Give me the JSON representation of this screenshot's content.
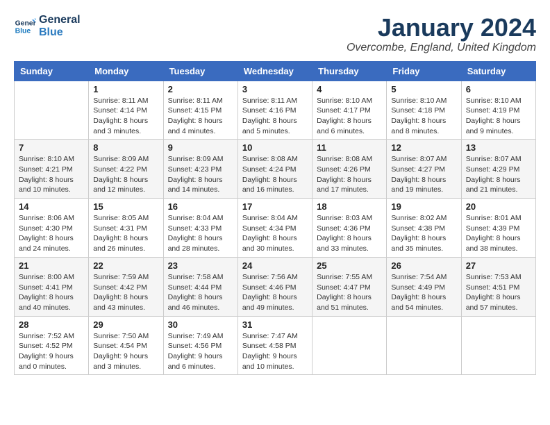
{
  "header": {
    "logo_line1": "General",
    "logo_line2": "Blue",
    "month_title": "January 2024",
    "location": "Overcombe, England, United Kingdom"
  },
  "days_of_week": [
    "Sunday",
    "Monday",
    "Tuesday",
    "Wednesday",
    "Thursday",
    "Friday",
    "Saturday"
  ],
  "weeks": [
    [
      {
        "day": "",
        "info": ""
      },
      {
        "day": "1",
        "info": "Sunrise: 8:11 AM\nSunset: 4:14 PM\nDaylight: 8 hours\nand 3 minutes."
      },
      {
        "day": "2",
        "info": "Sunrise: 8:11 AM\nSunset: 4:15 PM\nDaylight: 8 hours\nand 4 minutes."
      },
      {
        "day": "3",
        "info": "Sunrise: 8:11 AM\nSunset: 4:16 PM\nDaylight: 8 hours\nand 5 minutes."
      },
      {
        "day": "4",
        "info": "Sunrise: 8:10 AM\nSunset: 4:17 PM\nDaylight: 8 hours\nand 6 minutes."
      },
      {
        "day": "5",
        "info": "Sunrise: 8:10 AM\nSunset: 4:18 PM\nDaylight: 8 hours\nand 8 minutes."
      },
      {
        "day": "6",
        "info": "Sunrise: 8:10 AM\nSunset: 4:19 PM\nDaylight: 8 hours\nand 9 minutes."
      }
    ],
    [
      {
        "day": "7",
        "info": "Sunrise: 8:10 AM\nSunset: 4:21 PM\nDaylight: 8 hours\nand 10 minutes."
      },
      {
        "day": "8",
        "info": "Sunrise: 8:09 AM\nSunset: 4:22 PM\nDaylight: 8 hours\nand 12 minutes."
      },
      {
        "day": "9",
        "info": "Sunrise: 8:09 AM\nSunset: 4:23 PM\nDaylight: 8 hours\nand 14 minutes."
      },
      {
        "day": "10",
        "info": "Sunrise: 8:08 AM\nSunset: 4:24 PM\nDaylight: 8 hours\nand 16 minutes."
      },
      {
        "day": "11",
        "info": "Sunrise: 8:08 AM\nSunset: 4:26 PM\nDaylight: 8 hours\nand 17 minutes."
      },
      {
        "day": "12",
        "info": "Sunrise: 8:07 AM\nSunset: 4:27 PM\nDaylight: 8 hours\nand 19 minutes."
      },
      {
        "day": "13",
        "info": "Sunrise: 8:07 AM\nSunset: 4:29 PM\nDaylight: 8 hours\nand 21 minutes."
      }
    ],
    [
      {
        "day": "14",
        "info": "Sunrise: 8:06 AM\nSunset: 4:30 PM\nDaylight: 8 hours\nand 24 minutes."
      },
      {
        "day": "15",
        "info": "Sunrise: 8:05 AM\nSunset: 4:31 PM\nDaylight: 8 hours\nand 26 minutes."
      },
      {
        "day": "16",
        "info": "Sunrise: 8:04 AM\nSunset: 4:33 PM\nDaylight: 8 hours\nand 28 minutes."
      },
      {
        "day": "17",
        "info": "Sunrise: 8:04 AM\nSunset: 4:34 PM\nDaylight: 8 hours\nand 30 minutes."
      },
      {
        "day": "18",
        "info": "Sunrise: 8:03 AM\nSunset: 4:36 PM\nDaylight: 8 hours\nand 33 minutes."
      },
      {
        "day": "19",
        "info": "Sunrise: 8:02 AM\nSunset: 4:38 PM\nDaylight: 8 hours\nand 35 minutes."
      },
      {
        "day": "20",
        "info": "Sunrise: 8:01 AM\nSunset: 4:39 PM\nDaylight: 8 hours\nand 38 minutes."
      }
    ],
    [
      {
        "day": "21",
        "info": "Sunrise: 8:00 AM\nSunset: 4:41 PM\nDaylight: 8 hours\nand 40 minutes."
      },
      {
        "day": "22",
        "info": "Sunrise: 7:59 AM\nSunset: 4:42 PM\nDaylight: 8 hours\nand 43 minutes."
      },
      {
        "day": "23",
        "info": "Sunrise: 7:58 AM\nSunset: 4:44 PM\nDaylight: 8 hours\nand 46 minutes."
      },
      {
        "day": "24",
        "info": "Sunrise: 7:56 AM\nSunset: 4:46 PM\nDaylight: 8 hours\nand 49 minutes."
      },
      {
        "day": "25",
        "info": "Sunrise: 7:55 AM\nSunset: 4:47 PM\nDaylight: 8 hours\nand 51 minutes."
      },
      {
        "day": "26",
        "info": "Sunrise: 7:54 AM\nSunset: 4:49 PM\nDaylight: 8 hours\nand 54 minutes."
      },
      {
        "day": "27",
        "info": "Sunrise: 7:53 AM\nSunset: 4:51 PM\nDaylight: 8 hours\nand 57 minutes."
      }
    ],
    [
      {
        "day": "28",
        "info": "Sunrise: 7:52 AM\nSunset: 4:52 PM\nDaylight: 9 hours\nand 0 minutes."
      },
      {
        "day": "29",
        "info": "Sunrise: 7:50 AM\nSunset: 4:54 PM\nDaylight: 9 hours\nand 3 minutes."
      },
      {
        "day": "30",
        "info": "Sunrise: 7:49 AM\nSunset: 4:56 PM\nDaylight: 9 hours\nand 6 minutes."
      },
      {
        "day": "31",
        "info": "Sunrise: 7:47 AM\nSunset: 4:58 PM\nDaylight: 9 hours\nand 10 minutes."
      },
      {
        "day": "",
        "info": ""
      },
      {
        "day": "",
        "info": ""
      },
      {
        "day": "",
        "info": ""
      }
    ]
  ]
}
